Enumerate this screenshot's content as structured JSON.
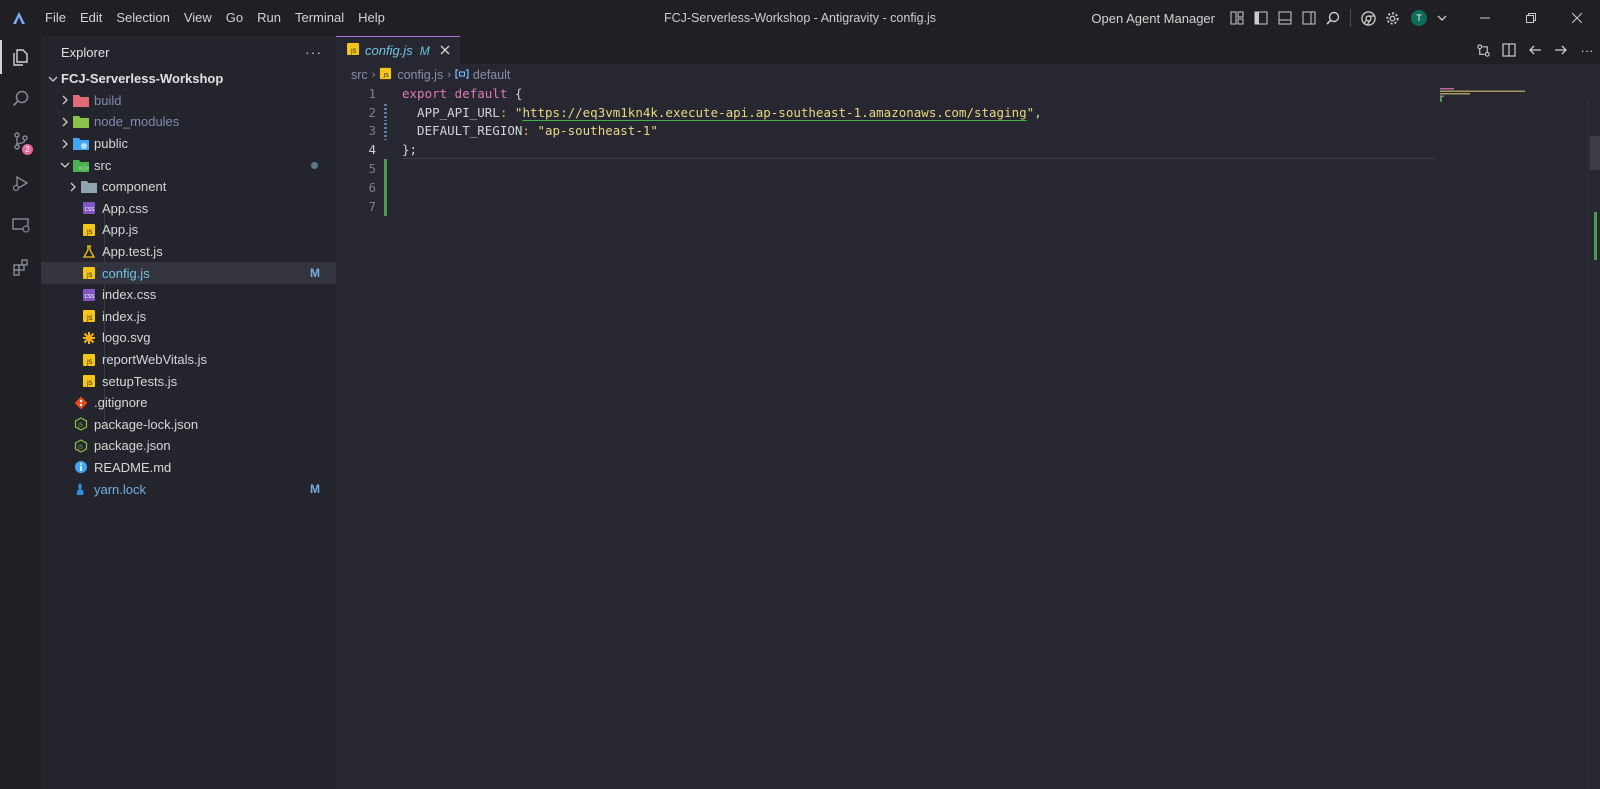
{
  "titlebar": {
    "menu": [
      "File",
      "Edit",
      "Selection",
      "View",
      "Go",
      "Run",
      "Terminal",
      "Help"
    ],
    "window_title": "FCJ-Serverless-Workshop - Antigravity - config.js",
    "agent_manager": "Open Agent Manager",
    "avatar_initial": "T"
  },
  "activitybar": {
    "items": [
      "explorer-icon",
      "search-icon",
      "source-control-icon",
      "run-debug-icon",
      "remote-explorer-icon",
      "extensions-icon"
    ],
    "source_control_badge": "2"
  },
  "sidebar": {
    "title": "Explorer",
    "more": "···",
    "root": "FCJ-Serverless-Workshop",
    "tree": [
      {
        "label": "build",
        "kind": "folder",
        "depth": 1,
        "dim": true
      },
      {
        "label": "node_modules",
        "kind": "folder",
        "depth": 1,
        "dim": true
      },
      {
        "label": "public",
        "kind": "folder",
        "depth": 1
      },
      {
        "label": "src",
        "kind": "folder-open",
        "depth": 1,
        "modified_dot": true
      },
      {
        "label": "component",
        "kind": "folder",
        "depth": 2
      },
      {
        "label": "App.css",
        "kind": "css",
        "depth": 2
      },
      {
        "label": "App.js",
        "kind": "js",
        "depth": 2
      },
      {
        "label": "App.test.js",
        "kind": "test",
        "depth": 2
      },
      {
        "label": "config.js",
        "kind": "js",
        "depth": 2,
        "selected": true,
        "flag": "M"
      },
      {
        "label": "index.css",
        "kind": "css",
        "depth": 2
      },
      {
        "label": "index.js",
        "kind": "js",
        "depth": 2
      },
      {
        "label": "logo.svg",
        "kind": "svg",
        "depth": 2
      },
      {
        "label": "reportWebVitals.js",
        "kind": "js",
        "depth": 2
      },
      {
        "label": "setupTests.js",
        "kind": "js",
        "depth": 2
      },
      {
        "label": ".gitignore",
        "kind": "git",
        "depth": 1
      },
      {
        "label": "package-lock.json",
        "kind": "json",
        "depth": 1
      },
      {
        "label": "package.json",
        "kind": "json",
        "depth": 1
      },
      {
        "label": "README.md",
        "kind": "info",
        "depth": 1
      },
      {
        "label": "yarn.lock",
        "kind": "yarn",
        "depth": 1,
        "modified": true,
        "flag": "M"
      }
    ]
  },
  "editor": {
    "tab": {
      "name": "config.js",
      "flag": "M"
    },
    "breadcrumb": [
      "src",
      "config.js",
      "default"
    ],
    "lines": [
      "1",
      "2",
      "3",
      "4",
      "5",
      "6",
      "7"
    ],
    "code": {
      "l1_kw": "export default",
      "l1_brace": "{",
      "l2_key": "  APP_API_URL",
      "l2_colon": ": ",
      "l2_q1": "\"",
      "l2_url": "https://eq3vm1kn4k.execute-api.ap-southeast-1.amazonaws.com/staging",
      "l2_q2": "\"",
      "l2_comma": ",",
      "l3_key": "  DEFAULT_REGION",
      "l3_colon": ": ",
      "l3_val": "\"ap-southeast-1\"",
      "l4": "};"
    }
  },
  "colors": {
    "accent_tab_border": "#9a7bd8",
    "modified": "#72aee0",
    "added_gutter": "#4a9c4a",
    "keyword": "#e17ab8",
    "string": "#e8d883"
  }
}
